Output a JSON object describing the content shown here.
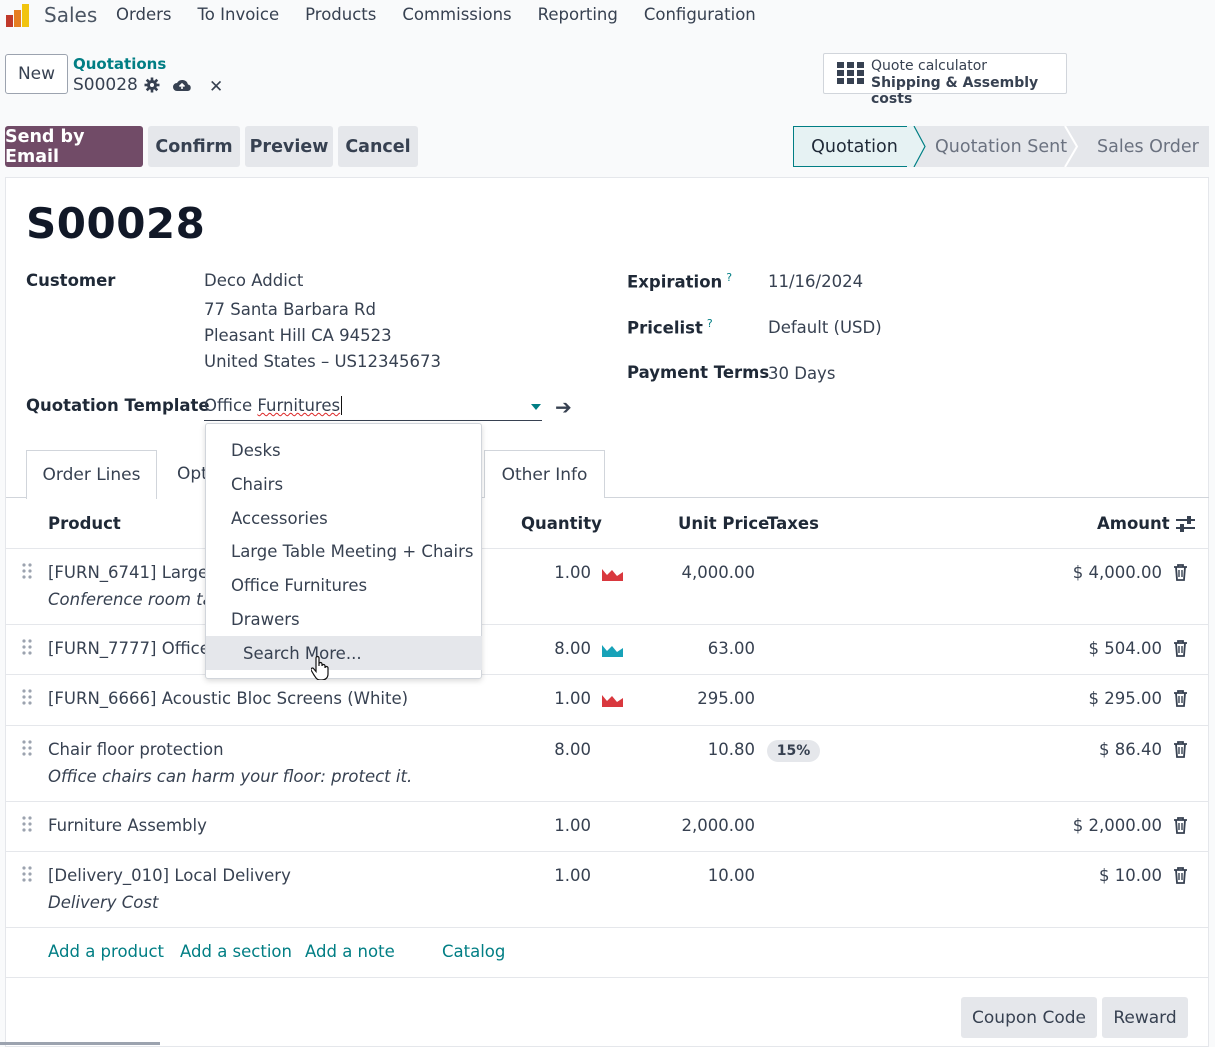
{
  "app": {
    "name": "Sales"
  },
  "menu": [
    "Orders",
    "To Invoice",
    "Products",
    "Commissions",
    "Reporting",
    "Configuration"
  ],
  "control": {
    "new_label": "New",
    "breadcrumb_parent": "Quotations",
    "breadcrumb_current": "S00028"
  },
  "smart_button": {
    "line1": "Quote calculator",
    "line2": "Shipping & Assembly costs",
    "icon": "grid-icon"
  },
  "actions": {
    "send": "Send by Email",
    "confirm": "Confirm",
    "preview": "Preview",
    "cancel": "Cancel"
  },
  "statusbar": {
    "quotation": "Quotation",
    "sent": "Quotation Sent",
    "order": "Sales Order"
  },
  "form": {
    "title": "S00028",
    "customer_label": "Customer",
    "customer_name": "Deco Addict",
    "addr1": "77 Santa Barbara Rd",
    "addr2": "Pleasant Hill CA 94523",
    "addr3": "United States – US12345673",
    "template_label": "Quotation Template",
    "template_value_a": "Office ",
    "template_value_b": "Furnitures",
    "expiration_label": "Expiration",
    "expiration_value": "11/16/2024",
    "pricelist_label": "Pricelist",
    "pricelist_value": "Default (USD)",
    "payment_label": "Payment Terms",
    "payment_value": "30 Days",
    "help_mark": "?"
  },
  "tabs": {
    "order_lines": "Order Lines",
    "optional": "Opt",
    "other_info": "Other Info"
  },
  "table": {
    "headers": {
      "product": "Product",
      "quantity": "Quantity",
      "unit_price": "Unit Price",
      "taxes": "Taxes",
      "amount": "Amount"
    },
    "rows": [
      {
        "product": "[FURN_6741] Large I",
        "desc": "Conference room tab",
        "qty": "1.00",
        "price": "4,000.00",
        "tax": "",
        "amount": "$ 4,000.00",
        "forecast": "red"
      },
      {
        "product": "[FURN_7777] Office",
        "desc": "",
        "qty": "8.00",
        "price": "63.00",
        "tax": "",
        "amount": "$ 504.00",
        "forecast": "green"
      },
      {
        "product": "[FURN_6666] Acoustic Bloc Screens (White)",
        "desc": "",
        "qty": "1.00",
        "price": "295.00",
        "tax": "",
        "amount": "$ 295.00",
        "forecast": "red"
      },
      {
        "product": "Chair floor protection",
        "desc": "Office chairs can harm your floor: protect it.",
        "qty": "8.00",
        "price": "10.80",
        "tax": "15%",
        "amount": "$ 86.40"
      },
      {
        "product": "Furniture Assembly",
        "desc": "",
        "qty": "1.00",
        "price": "2,000.00",
        "tax": "",
        "amount": "$ 2,000.00"
      },
      {
        "product": "[Delivery_010] Local Delivery",
        "desc": "Delivery Cost",
        "qty": "1.00",
        "price": "10.00",
        "tax": "",
        "amount": "$ 10.00"
      }
    ],
    "links": {
      "add_product": "Add a product",
      "add_section": "Add a section",
      "add_note": "Add a note",
      "catalog": "Catalog"
    }
  },
  "footer_buttons": {
    "coupon": "Coupon Code",
    "reward": "Reward"
  },
  "dropdown": {
    "items": [
      "Desks",
      "Chairs",
      "Accessories",
      "Large Table Meeting + Chairs",
      "Office Furnitures",
      "Drawers"
    ],
    "search_more": "Search More..."
  },
  "colors": {
    "brand": "#714b67",
    "accent": "#017e84",
    "forecast_red": "#d9383e",
    "forecast_green": "#17a2b8"
  }
}
